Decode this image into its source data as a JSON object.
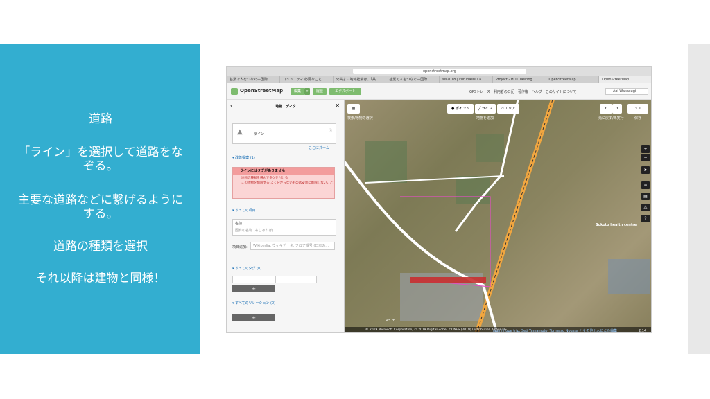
{
  "slide": {
    "lines": [
      "道路",
      "「ライン」を選択して道路をなぞる。",
      "主要な道路などに繋げるようにする。",
      "道路の種類を選択",
      "それ以降は建物と同様！"
    ]
  },
  "browser": {
    "url": "openstreetmap.org",
    "tabs": [
      "基業で人をつなぐ—国際…",
      "コミュニティ 必要なこと…",
      "公共よい地域社会は、「共…",
      "基業で人をつなぐ—国際…",
      "sis2018 | Furuhashi La…",
      "Project - HOT Tasking…",
      "OpenStreetMap",
      "OpenStreetMap"
    ]
  },
  "osm": {
    "brand": "OpenStreetMap",
    "edit_label": "編集",
    "history_label": "履歴",
    "export_label": "エクスポート",
    "nav": "GPSトレース　利用者の日記　著作権　ヘルプ　このサイトについて",
    "user": "Aoi Wakasugi"
  },
  "sidebar": {
    "title": "地物エディタ",
    "preset_label": "ライン",
    "zoom_link": "ここにズーム",
    "issues_header": "改善提案 (1)",
    "warning_title": "ラインにはタグがありません",
    "warning_item1": "地物の種類を選んでタグを付ける",
    "warning_item2": "この地物を削除する(よく分からないものは安易に削除しないこと)",
    "all_fields_header": "すべての項目",
    "name_label": "名前",
    "name_placeholder": "固有の名称 (もしあれば)",
    "add_field_label": "項目追加:",
    "add_field_placeholder": "Wikipedia, ウィキデータ, フロア番号 (日本の…",
    "tags_header": "すべてのタグ (0)",
    "relations_header": "すべてのリレーション (0)",
    "plus": "+"
  },
  "map": {
    "point_label": "ポイント",
    "line_label": "ライン",
    "area_label": "エリア",
    "left_hint": "検索/地物の選択",
    "mid_hint": "地物を追加",
    "undo_hint": "元に戻す/再実行",
    "save_count": "1",
    "save_hint": "保存",
    "place_label": "Sokoto health centre",
    "scale_label": "45 m",
    "attribution": "© 2019 Microsoft Corporation, © 2019 DigitalGlobe, ©CNES (2019) Distribution Airbus DS",
    "editors": "naomi hope trip, Seti Yamamoto, Tomasso Noussa とその他 | 人による編集",
    "version": "2.14"
  }
}
